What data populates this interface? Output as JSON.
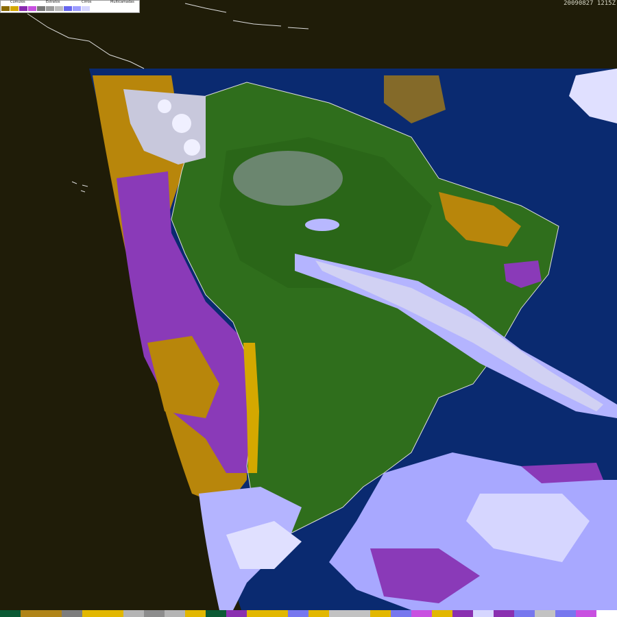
{
  "header": {
    "timestamp": "20090827 1215Z"
  },
  "legend": {
    "labels": [
      "Cúmulos",
      "Estratos",
      "Cirros",
      "Multicamadas"
    ],
    "swatches": [
      "#8a6a00",
      "#d4a800",
      "#8a2ab0",
      "#c850e0",
      "#777777",
      "#9a9a9a",
      "#bcbcbc",
      "#6666ee",
      "#9c9cff",
      "#d6d6ff"
    ]
  },
  "colors": {
    "space": "#1f1c08",
    "ocean": "#0a2a70",
    "land": "#2f6e1c",
    "cumulus": "#b8860b",
    "stratus": "#8a3ab8",
    "cirrus": "#c8c8dc",
    "multilayer": "#a8a8ff",
    "coastline": "#dddddd"
  },
  "bottom_bar": {
    "swatches": [
      "#0b5a34",
      "#b08418",
      "#b08418",
      "#7d7d7d",
      "#e2b700",
      "#e2b700",
      "#b4b4b4",
      "#8d8d8d",
      "#b4b4b4",
      "#e2b700",
      "#0b5a34",
      "#8a30b0",
      "#e2b700",
      "#e2b700",
      "#7777ee",
      "#e2b700",
      "#c2c2c2",
      "#c2c2c2",
      "#e2b700",
      "#7777ee",
      "#c850e0",
      "#e2b700",
      "#8a30b0",
      "#d6d6ff",
      "#8a30b0",
      "#7777ee",
      "#c2c2c2",
      "#7777ee",
      "#c850e0",
      "#ffffff"
    ]
  }
}
